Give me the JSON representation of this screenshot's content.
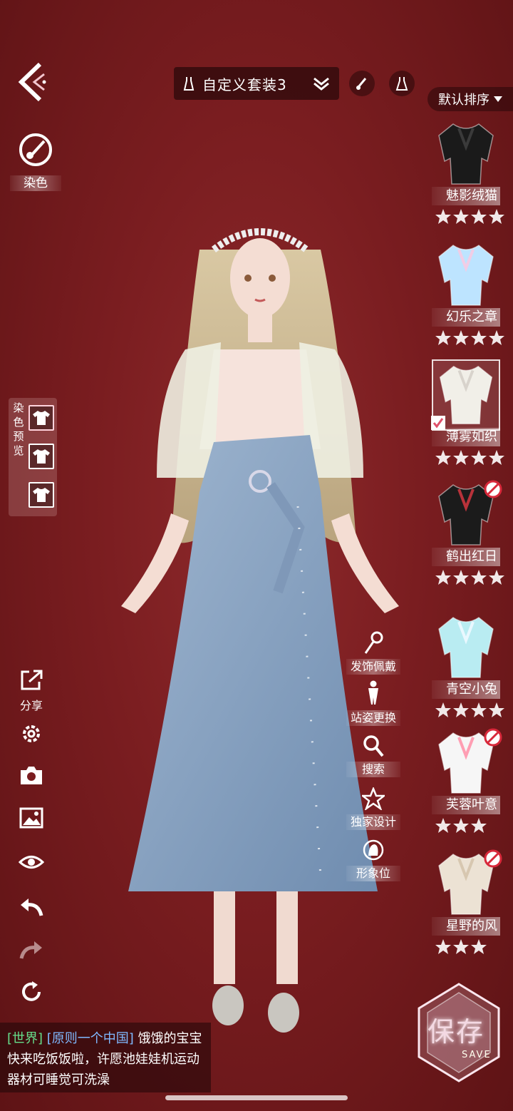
{
  "topbar": {
    "outfit_name": "自定义套装3",
    "sort_label": "默认排序"
  },
  "left": {
    "dye_label": "染色",
    "dye_preview_label": "染色预览",
    "share_label": "分享"
  },
  "actions": [
    {
      "label": "发饰佩戴",
      "icon": "hairpin-icon"
    },
    {
      "label": "站姿更换",
      "icon": "pose-icon"
    },
    {
      "label": "搜索",
      "icon": "search-icon"
    },
    {
      "label": "独家设计",
      "icon": "star-icon"
    },
    {
      "label": "形象位",
      "icon": "avatar-icon"
    }
  ],
  "items": [
    {
      "name": "魅影绒猫",
      "stars": 4,
      "ban": false,
      "selected": false,
      "colors": [
        "#1a1a1a",
        "#3a3a3a"
      ]
    },
    {
      "name": "幻乐之章",
      "stars": 4,
      "ban": false,
      "selected": false,
      "colors": [
        "#bde4ff",
        "#f1cde6"
      ]
    },
    {
      "name": "薄雾如织",
      "stars": 4,
      "ban": false,
      "selected": true,
      "colors": [
        "#f1efe8",
        "#d8d3cc"
      ]
    },
    {
      "name": "鹤出红日",
      "stars": 4,
      "ban": true,
      "selected": false,
      "colors": [
        "#1b1b1b",
        "#b8323a"
      ]
    },
    {
      "name": "青空小兔",
      "stars": 4,
      "ban": false,
      "selected": false,
      "colors": [
        "#b9ecf2",
        "#e9f8ff"
      ]
    },
    {
      "name": "芙蓉叶意",
      "stars": 3,
      "ban": true,
      "selected": false,
      "colors": [
        "#f6f6f6",
        "#ff9eb3"
      ]
    },
    {
      "name": "星野的风",
      "stars": 3,
      "ban": true,
      "selected": false,
      "colors": [
        "#ece2d4",
        "#d7c7b0"
      ]
    }
  ],
  "save": {
    "label": "保存",
    "sub": "SAVE"
  },
  "chat": {
    "channel": "[世界]",
    "guild": "[原则一个中国]",
    "message": "饿饿的宝宝快来吃饭饭啦，许愿池娃娃机运动器材可睡觉可洗澡"
  },
  "colors": {
    "background": "#7a1d20",
    "chat_channel": "#66e08c",
    "chat_guild": "#7fb9ff"
  }
}
